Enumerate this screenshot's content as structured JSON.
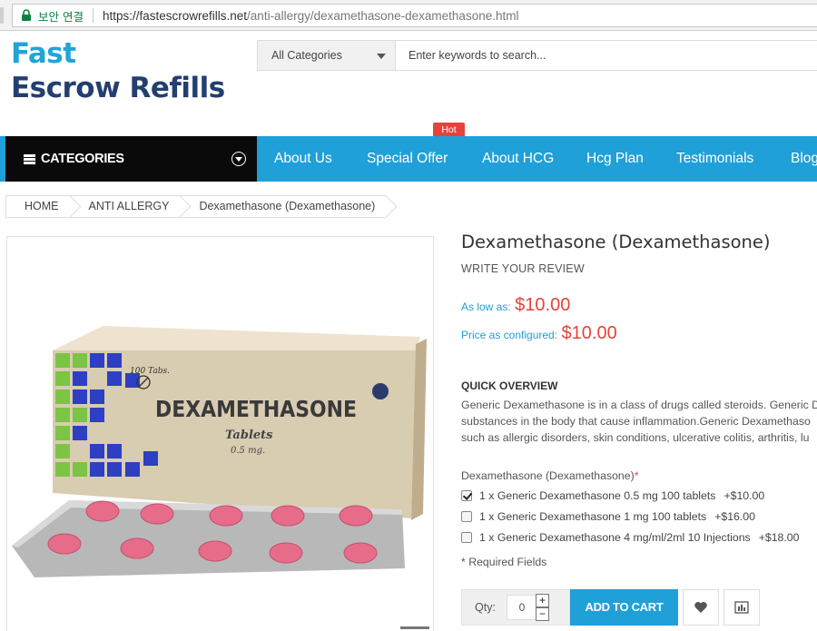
{
  "browser": {
    "secure_label": "보안 연결",
    "url_host": "https://fastescrowrefills.net",
    "url_path": "/anti-allergy/dexamethasone-dexamethasone.html"
  },
  "header": {
    "logo_line1": "Fast",
    "logo_line2": "Escrow Refills",
    "category_select": "All Categories",
    "search_placeholder": "Enter keywords to search..."
  },
  "nav": {
    "categories_label": "CATEGORIES",
    "hot_badge": "Hot",
    "items": [
      "About Us",
      "Special Offer",
      "About HCG",
      "Hcg Plan",
      "Testimonials",
      "Blog"
    ]
  },
  "breadcrumb": [
    "HOME",
    "ANTI ALLERGY",
    "Dexamethasone (Dexamethasone)"
  ],
  "product": {
    "title": "Dexamethasone (Dexamethasone)",
    "review_link": "WRITE YOUR REVIEW",
    "as_low_as_label": "As low as:",
    "as_low_as_price": "$10.00",
    "configured_label": "Price as configured:",
    "configured_price": "$10.00",
    "box_count": "100 Tabs.",
    "box_name": "DEXAMETHASONE",
    "box_form": "Tablets",
    "box_strength": "0.5 mg.",
    "quick_overview_title": "QUICK OVERVIEW",
    "overview_lines": [
      "Generic Dexamethasone is in a class of drugs called steroids. Generic D",
      "substances in the body that cause inflammation.Generic Dexamethaso",
      "such as allergic disorders, skin conditions, ulcerative colitis, arthritis, lu"
    ],
    "options_title": "Dexamethasone (Dexamethasone)",
    "required_mark": "*",
    "options": [
      {
        "label": "1 x Generic Dexamethasone 0.5 mg 100 tablets",
        "extra": "+$10.00",
        "checked": true
      },
      {
        "label": "1 x Generic Dexamethasone 1 mg 100 tablets",
        "extra": "+$16.00",
        "checked": false
      },
      {
        "label": "1 x Generic Dexamethasone 4 mg/ml/2ml 10 Injections",
        "extra": "+$18.00",
        "checked": false
      }
    ],
    "required_fields": "* Required Fields",
    "qty_label": "Qty:",
    "qty_value": "0",
    "add_to_cart": "ADD TO CART"
  },
  "colors": {
    "brand_blue": "#1fa0d8",
    "logo_dark": "#233f70",
    "price_red": "#e8423b"
  },
  "icons": [
    "lock-icon",
    "menu-icon",
    "chevron-down-circle-icon",
    "heart-icon",
    "compare-icon",
    "plus-icon",
    "minus-icon"
  ]
}
